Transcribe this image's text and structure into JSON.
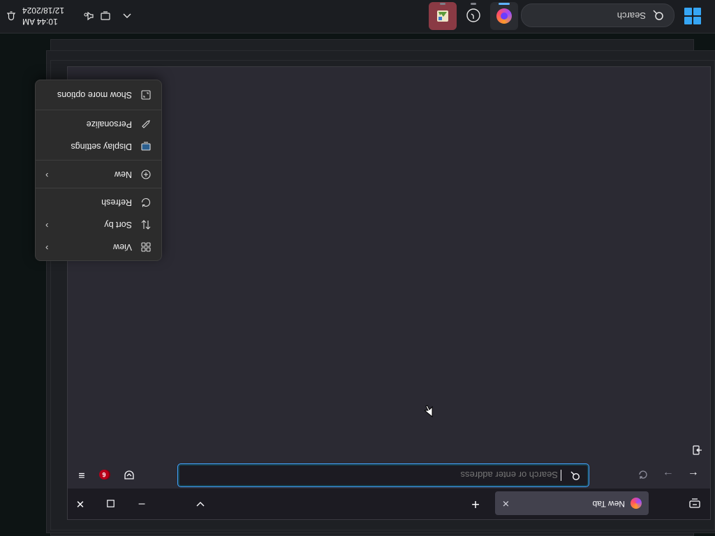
{
  "taskbar": {
    "search_placeholder": "Search",
    "clock_time": "10:44 AM",
    "clock_date": "12/18/2024",
    "apps": [
      "firefox-icon",
      "clock-icon",
      "photo-viewer-icon"
    ],
    "accent": "#36a6f5"
  },
  "browser": {
    "tab_title": "New Tab",
    "url_placeholder": "Search or enter address",
    "extension_badge": "6",
    "accent": "#45a1ff"
  },
  "context_menu": {
    "items": [
      {
        "label": "View",
        "icon": "grid-icon",
        "submenu": true
      },
      {
        "label": "Sort by",
        "icon": "sort-icon",
        "submenu": true
      },
      {
        "label": "Refresh",
        "icon": "refresh-icon",
        "submenu": false
      },
      {
        "label": "New",
        "icon": "plus-circle-icon",
        "submenu": true
      },
      {
        "label": "Display settings",
        "icon": "display-icon",
        "submenu": false
      },
      {
        "label": "Personalize",
        "icon": "pen-icon",
        "submenu": false
      },
      {
        "label": "Show more options",
        "icon": "expand-icon",
        "submenu": false
      }
    ]
  }
}
